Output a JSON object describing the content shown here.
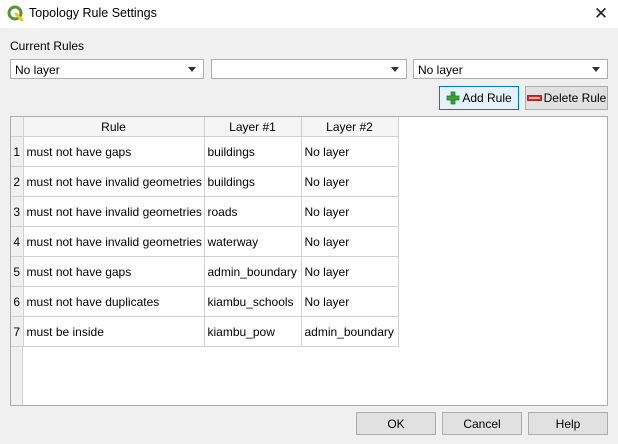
{
  "window": {
    "title": "Topology Rule Settings",
    "close_symbol": "✕",
    "app_icon": "qgis-icon"
  },
  "current_rules": {
    "label": "Current Rules",
    "combo_layer1": {
      "value": "No layer"
    },
    "combo_rule": {
      "value": ""
    },
    "combo_layer2": {
      "value": "No layer"
    }
  },
  "actions": {
    "add_rule": {
      "label": "Add Rule",
      "icon": "plus-icon",
      "color": "#3aa835"
    },
    "delete_rule": {
      "label": "Delete Rule",
      "icon": "minus-icon",
      "color": "#d42b2b"
    }
  },
  "table": {
    "columns": [
      "Rule",
      "Layer #1",
      "Layer #2"
    ],
    "rows": [
      {
        "num": "1",
        "rule": "must not have gaps",
        "layer1": "buildings",
        "layer2": "No layer"
      },
      {
        "num": "2",
        "rule": "must not have invalid geometries",
        "layer1": "buildings",
        "layer2": "No layer"
      },
      {
        "num": "3",
        "rule": "must not have invalid geometries",
        "layer1": "roads",
        "layer2": "No layer"
      },
      {
        "num": "4",
        "rule": "must not have invalid geometries",
        "layer1": "waterway",
        "layer2": "No layer"
      },
      {
        "num": "5",
        "rule": "must not have gaps",
        "layer1": "admin_boundary",
        "layer2": "No layer"
      },
      {
        "num": "6",
        "rule": "must not have duplicates",
        "layer1": "kiambu_schools",
        "layer2": "No layer"
      },
      {
        "num": "7",
        "rule": "must be inside",
        "layer1": "kiambu_pow",
        "layer2": "admin_boundary"
      }
    ]
  },
  "footer": {
    "ok": "OK",
    "cancel": "Cancel",
    "help": "Help"
  }
}
